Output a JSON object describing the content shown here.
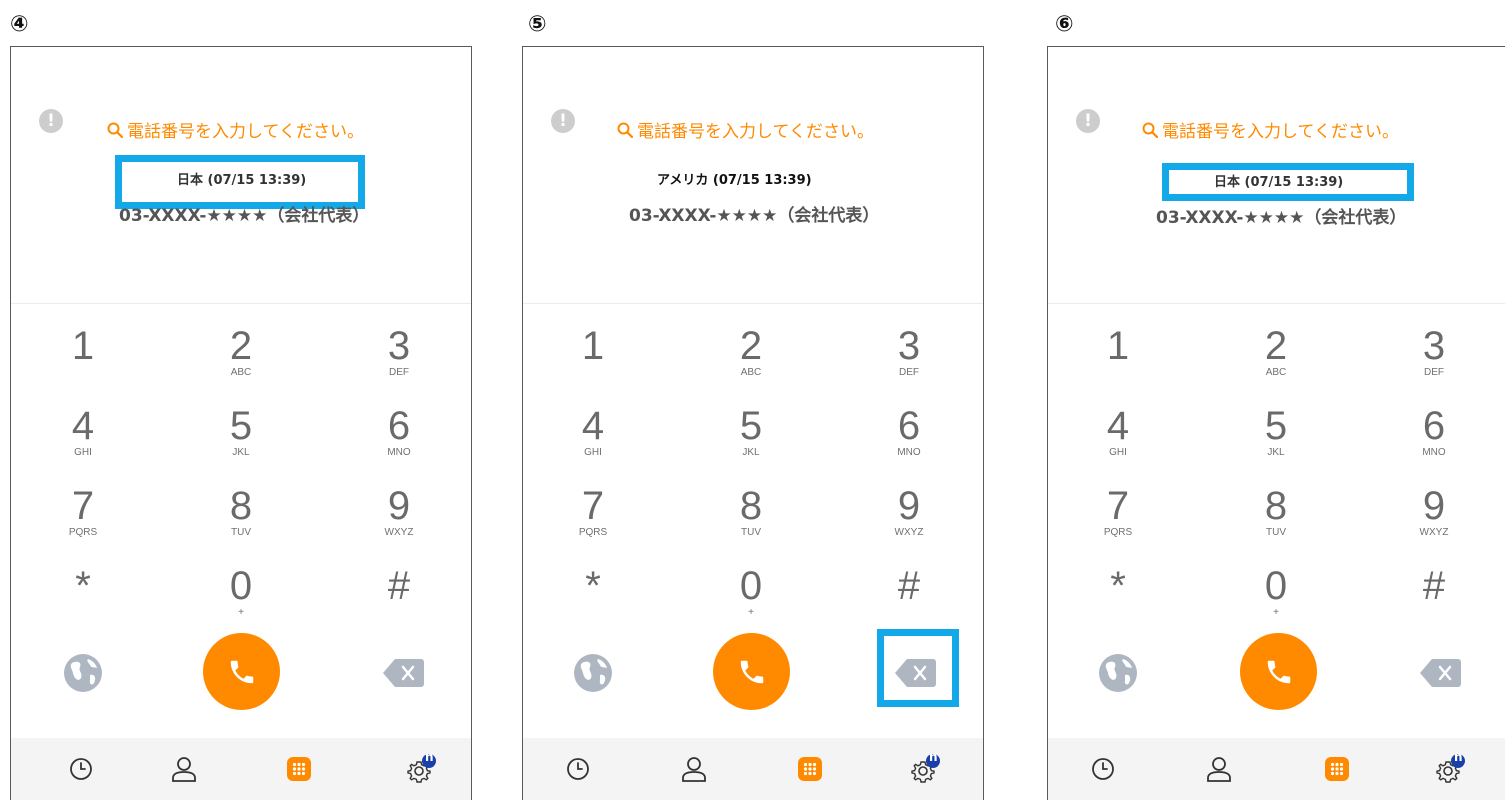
{
  "panels": [
    {
      "step": "④",
      "prompt": "電話番号を入力してください。",
      "location_time": "日本 (07/15 13:39)",
      "number": "03-XXXX-★★★★（会社代表）"
    },
    {
      "step": "⑤",
      "prompt": "電話番号を入力してください。",
      "location_time": "アメリカ (07/15 13:39)",
      "number": "03-XXXX-★★★★（会社代表）"
    },
    {
      "step": "⑥",
      "prompt": "電話番号を入力してください。",
      "location_time": "日本 (07/15 13:39)",
      "number": "03-XXXX-★★★★（会社代表）"
    }
  ],
  "keypad": {
    "k1": {
      "digit": "1",
      "letters": ""
    },
    "k2": {
      "digit": "2",
      "letters": "ABC"
    },
    "k3": {
      "digit": "3",
      "letters": "DEF"
    },
    "k4": {
      "digit": "4",
      "letters": "GHI"
    },
    "k5": {
      "digit": "5",
      "letters": "JKL"
    },
    "k6": {
      "digit": "6",
      "letters": "MNO"
    },
    "k7": {
      "digit": "7",
      "letters": "PQRS"
    },
    "k8": {
      "digit": "8",
      "letters": "TUV"
    },
    "k9": {
      "digit": "9",
      "letters": "WXYZ"
    },
    "kstar": {
      "digit": "*",
      "letters": ""
    },
    "k0": {
      "digit": "0",
      "letters": "+"
    },
    "khash": {
      "digit": "#",
      "letters": ""
    }
  },
  "settings_badge": "n",
  "colors": {
    "accent": "#ff8a00",
    "highlight": "#13a9e8"
  },
  "icons": [
    "warning-icon",
    "search-icon",
    "globe-icon",
    "phone-icon",
    "backspace-icon",
    "history-icon",
    "contacts-icon",
    "dialpad-icon",
    "settings-icon"
  ]
}
